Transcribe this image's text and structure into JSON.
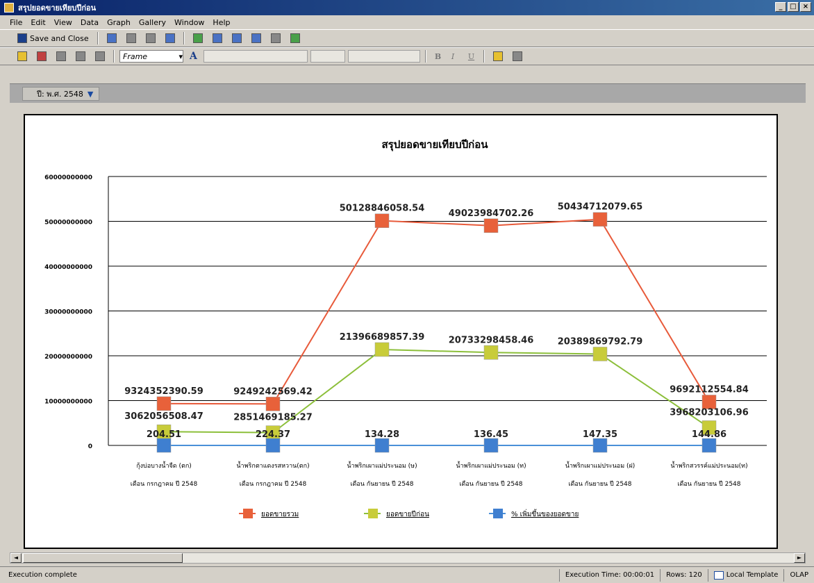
{
  "window": {
    "title": "สรุปยอดขายเทียบปีก่อน",
    "buttons": [
      "_",
      "□",
      "×"
    ]
  },
  "menu": [
    "File",
    "Edit",
    "View",
    "Data",
    "Graph",
    "Gallery",
    "Window",
    "Help"
  ],
  "toolbar": {
    "save_close": "Save and Close",
    "frame_value": "Frame",
    "font_button": "A",
    "bold": "B",
    "italic": "I",
    "underline": "U"
  },
  "filter": {
    "label": "ปี: พ.ศ. 2548"
  },
  "status": {
    "message": "Execution complete",
    "execution_time": "Execution Time: 00:00:01",
    "rows": "Rows: 120",
    "template": "Local Template",
    "mode": "OLAP"
  },
  "scroll": {
    "left": "◄",
    "right": "►"
  },
  "colors": {
    "series1": "#e8613a",
    "series2": "#c8cc3a",
    "series3": "#3f7fd0",
    "line1": "#e85a3a",
    "line2": "#8cbf3a",
    "line3": "#4a90d8"
  },
  "chart_data": {
    "type": "line",
    "title": "สรุปยอดขายเทียบปีก่อน",
    "categories": [
      [
        "กุ้งบ่อบางน้ำจืด (ตก)",
        "เดือน กรกฎาคม ปี 2548"
      ],
      [
        "น้ำพริกตาแดงรสหวาน(ตก)",
        "เดือน กรกฎาคม ปี 2548"
      ],
      [
        "น้ำพริกเผาแม่ประนอม (ษ)",
        "เดือน กันยายน ปี 2548"
      ],
      [
        "น้ำพริกเผาแม่ประนอม (ท)",
        "เดือน กันยายน ปี 2548"
      ],
      [
        "น้ำพริกเผาแม่ประนอม (ฝ)",
        "เดือน กันยายน ปี 2548"
      ],
      [
        "น้ำพริกสวรรค์แม่ประนอม(ท)",
        "เดือน กันยายน ปี 2548"
      ]
    ],
    "y_ticks": [
      "0",
      "10000000000",
      "20000000000",
      "30000000000",
      "40000000000",
      "50000000000",
      "60000000000"
    ],
    "ylim": [
      0,
      60000000000
    ],
    "series": [
      {
        "name": "ยอดขายรวม",
        "values": [
          9324352390.59,
          9249242569.42,
          50128846058.54,
          49023984702.26,
          50434712079.65,
          9692112554.84
        ],
        "labels": [
          "9324352390.59",
          "9249242569.42",
          "50128846058.54",
          "49023984702.26",
          "50434712079.65",
          "9692112554.84"
        ]
      },
      {
        "name": "ยอดขายปีก่อน",
        "values": [
          3062056508.47,
          2851469185.27,
          21396689857.39,
          20733298458.46,
          20389869792.79,
          3968203106.96
        ],
        "labels": [
          "3062056508.47",
          "2851469185.27",
          "21396689857.39",
          "20733298458.46",
          "20389869792.79",
          "3968203106.96"
        ]
      },
      {
        "name": "% เพิ่มขึ้นของยอดขาย",
        "values": [
          204.51,
          224.37,
          134.28,
          136.45,
          147.35,
          144.86
        ],
        "labels": [
          "204.51",
          "224.37",
          "134.28",
          "136.45",
          "147.35",
          "144.86"
        ]
      }
    ],
    "legend_position": "bottom",
    "grid": true
  }
}
